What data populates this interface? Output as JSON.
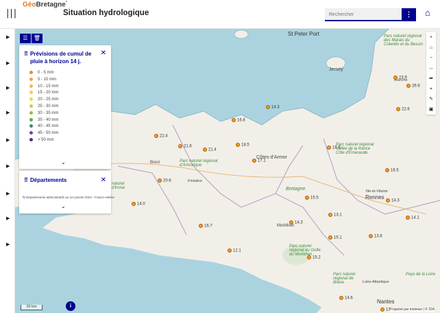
{
  "header": {
    "logo_geo": "Géo",
    "logo_rest": "Bretagne",
    "title": "Situation hydrologique",
    "search_placeholder": "Rechercher"
  },
  "panels": {
    "rain": {
      "title": "Prévisions de cumul de pluie à horizon 14 j.",
      "legend": [
        {
          "label": "0 - 5 mm",
          "color": "#f08a24"
        },
        {
          "label": "5 - 10 mm",
          "color": "#f0a14a"
        },
        {
          "label": "10 - 15 mm",
          "color": "#f5b54a"
        },
        {
          "label": "15 - 20 mm",
          "color": "#f2c95a"
        },
        {
          "label": "20 - 25 mm",
          "color": "#e8d84a"
        },
        {
          "label": "25 - 30 mm",
          "color": "#c3cf4a"
        },
        {
          "label": "30 - 35 mm",
          "color": "#8fc04a"
        },
        {
          "label": "35 - 40 mm",
          "color": "#5ea94a"
        },
        {
          "label": "40 - 45 mm",
          "color": "#3a8c6b"
        },
        {
          "label": "45 - 50 mm",
          "color": "#6a4c93"
        },
        {
          "label": "> 50 mm",
          "color": "#5a2a7a"
        }
      ]
    },
    "depts": {
      "title": "Départements",
      "source": "Départements administratifs au 1er janvier 2024 - France entière"
    }
  },
  "map": {
    "labels": {
      "stpeter": "St Peter Port",
      "jersey": "Jersey",
      "cotes": "Côtes-d'Armor",
      "bretagne": "Bretagne",
      "illevil": "Ille-et-Vilaine",
      "rennes": "Rennes",
      "morbihan": "Morbihan",
      "finistere": "Finistère",
      "loireatl": "Loire-Atlantique",
      "nantes": "Nantes",
      "manche": "Manche",
      "paysloire": "Pays de la Loire",
      "brest": "Brest",
      "pnr_armorique": "Parc naturel régional d'Armorique",
      "pnr_cotentin": "Parc naturel régional des Marais du Cotentin et du Bessin",
      "pnr_rance": "Parc naturel régional Vallée de la Rance Côte d'Émeraude",
      "pnr_golfe": "Parc naturel régional du Golfe du Morbihan",
      "pnr_briere": "Parc naturel régional de Brière",
      "iroise": "naturel d'Iroise"
    },
    "stations": [
      "14.3",
      "16.8",
      "18.5",
      "21.6",
      "21.4",
      "17.1",
      "18.9",
      "14.0",
      "15.5",
      "16.5",
      "14.3",
      "13.1",
      "14.3",
      "15.1",
      "13.6",
      "14.1",
      "12.1",
      "15.2",
      "23.9",
      "26.6",
      "22.6",
      "22.4",
      "20.6",
      "16.7",
      "14.6",
      "13"
    ],
    "scale": "20 km",
    "credit": "Propulsé par mviewer | © 334"
  },
  "colors": {
    "accent": "#000091",
    "land": "#f2efe9",
    "sea": "#aad3df"
  }
}
